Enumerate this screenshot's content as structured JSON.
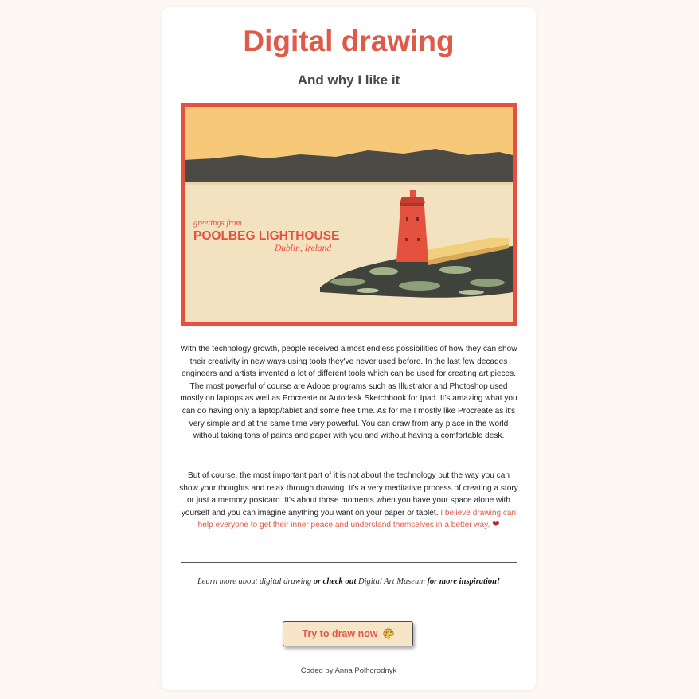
{
  "header": {
    "title": "Digital drawing",
    "subtitle": "And why I like it"
  },
  "illustration": {
    "greeting": "greetings from",
    "place": "POOLBEG LIGHTHOUSE",
    "location": "Dublin, Ireland"
  },
  "article": {
    "paragraph1": "With the technology growth, people received almost endless possibilities of how they can show their creativity in new ways using tools they've never used before. In the last few decades engineers and artists invented a lot of different tools which can be used for creating art pieces. The most powerful of course are Adobe programs such as Illustrator and Photoshop used mostly on laptops as well as Procreate or Autodesk Sketchbook for Ipad. It's amazing what you can do having only a laptop/tablet and some free time. As for me I mostly like Procreate as it's very simple and at the same time very powerful. You can draw from any place in the world without taking tons of paints and paper with you and without having a comfortable desk.",
    "paragraph2_plain": "But of course, the most important part of it is not about the technology but the way you can show your thoughts and relax through drawing. It's a very meditative process of creating a story or just a memory postcard. It's about those moments when you have your space alone with yourself and you can imagine anything you want on your paper or tablet.",
    "paragraph2_accent": "I believe drawing can help everyone to get their inner peace and understand themselves in a better way.",
    "heart": "❤"
  },
  "links": {
    "learn_more": "Learn more about digital drawing",
    "or_check_out": "or check out",
    "museum": "Digital Art Museum",
    "for_more": "for more inspiration!"
  },
  "cta": {
    "label": "Try to draw now",
    "icon": "palette-icon"
  },
  "footer": {
    "credit": "Coded by Anna Polhorodnyk"
  },
  "colors": {
    "page_background": "#fdf8f3",
    "card_background": "#ffffff",
    "accent": "#e05a4a",
    "button_background": "#f6e6c7"
  }
}
